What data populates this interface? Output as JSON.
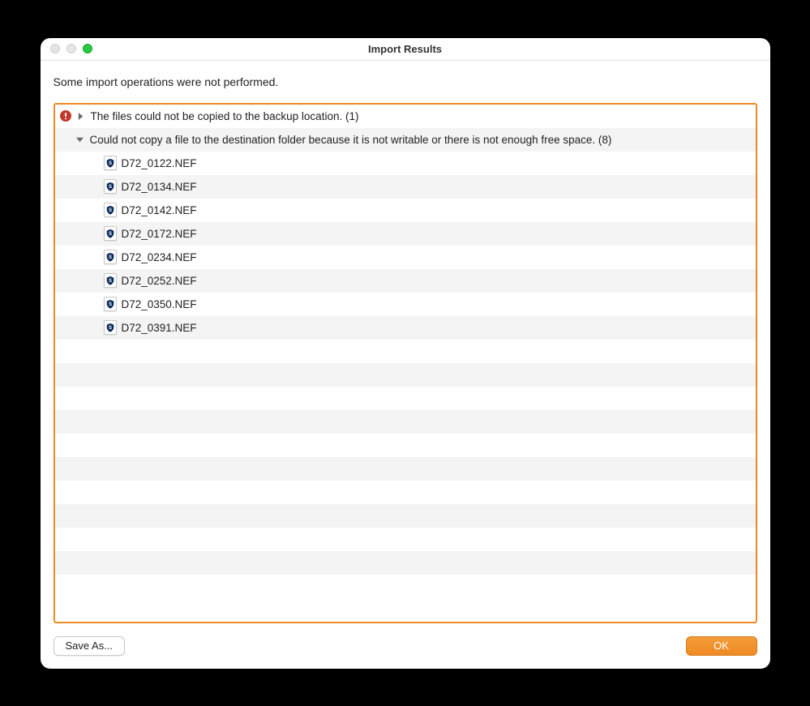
{
  "window": {
    "title": "Import Results"
  },
  "summary": "Some import operations were not performed.",
  "tree": {
    "group1": {
      "label": "The files could not be copied to the backup location. (1)",
      "expanded": false
    },
    "group2": {
      "label": "Could not copy a file to the destination folder because it is not writable or there is not enough free space. (8)",
      "expanded": true,
      "files": [
        "D72_0122.NEF",
        "D72_0134.NEF",
        "D72_0142.NEF",
        "D72_0172.NEF",
        "D72_0234.NEF",
        "D72_0252.NEF",
        "D72_0350.NEF",
        "D72_0391.NEF"
      ]
    }
  },
  "buttons": {
    "save_as": "Save As...",
    "ok": "OK"
  },
  "colors": {
    "accent": "#ee8a23",
    "alert": "#c0392b"
  }
}
